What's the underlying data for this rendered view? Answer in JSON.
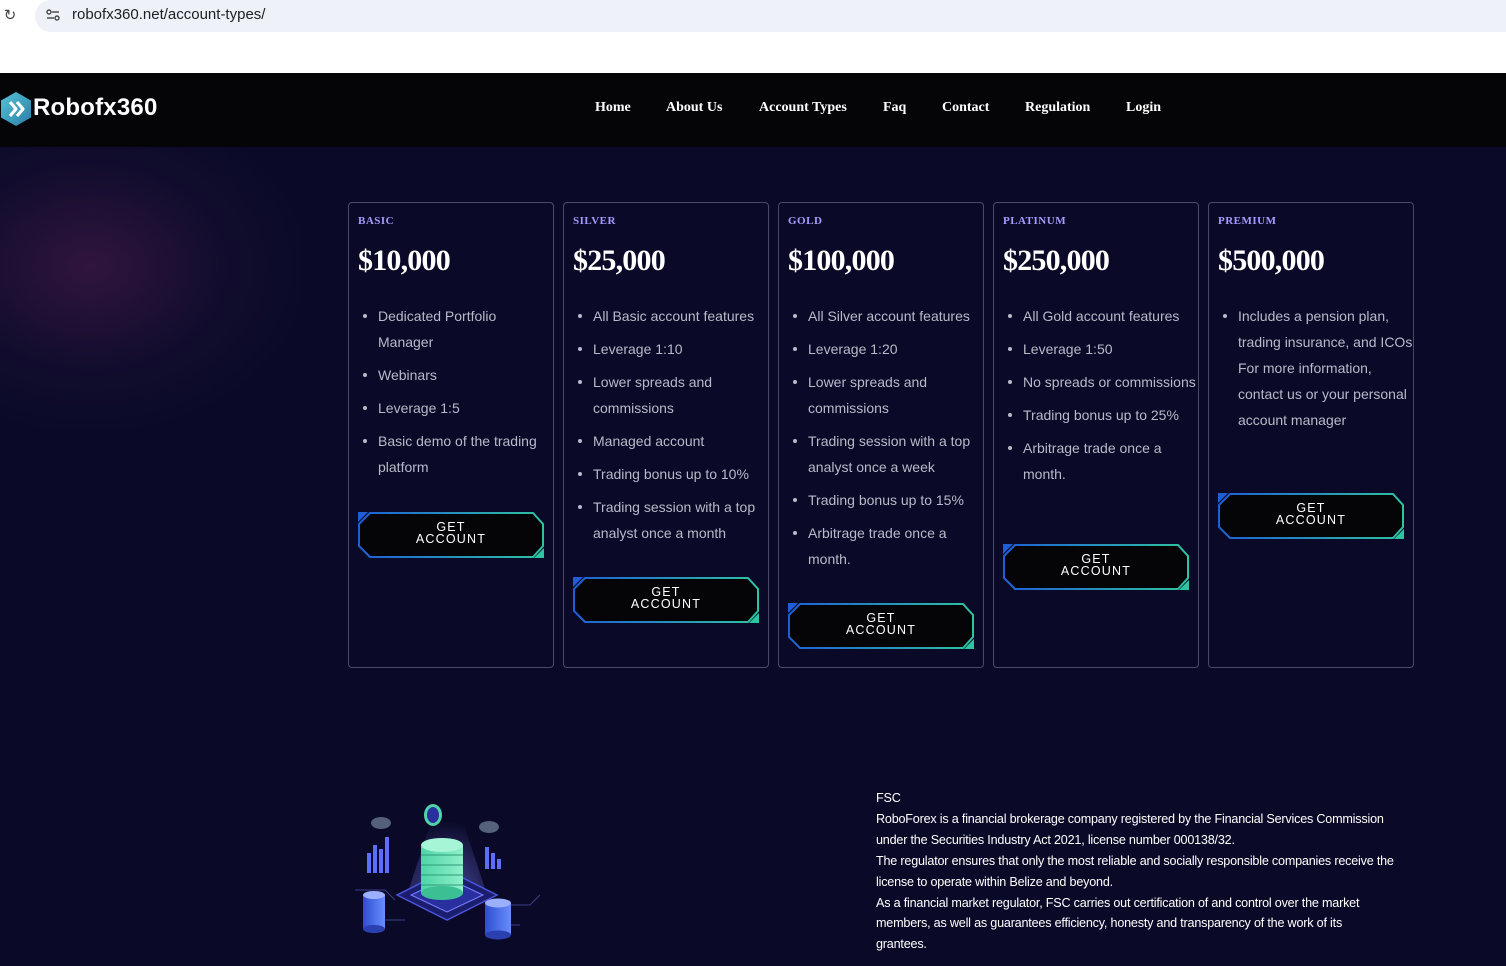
{
  "browser": {
    "url": "robofx360.net/account-types/"
  },
  "brand": {
    "name": "Robofx360"
  },
  "nav": {
    "items": [
      "Home",
      "About Us",
      "Account Types",
      "Faq",
      "Contact",
      "Regulation",
      "Login"
    ]
  },
  "plans": [
    {
      "tier": "BASIC",
      "price": "$10,000",
      "features": [
        "Dedicated Portfolio Manager",
        "Webinars",
        "Leverage 1:5",
        "Basic demo of the trading platform"
      ],
      "button": "GET ACCOUNT"
    },
    {
      "tier": "SILVER",
      "price": "$25,000",
      "features": [
        "All Basic account features",
        "Leverage 1:10",
        "Lower spreads and commissions",
        "Managed account",
        "Trading bonus up to 10%",
        "Trading session with a top analyst once a month"
      ],
      "button": "GET ACCOUNT"
    },
    {
      "tier": "GOLD",
      "price": "$100,000",
      "features": [
        "All Silver account features",
        "Leverage 1:20",
        "Lower spreads and commissions",
        "Trading session with a top analyst once a week",
        "Trading bonus up to 15%",
        "Arbitrage trade once a month."
      ],
      "button": "GET ACCOUNT"
    },
    {
      "tier": "PLATINUM",
      "price": "$250,000",
      "features": [
        "All Gold account features",
        "Leverage 1:50",
        "No spreads or commissions",
        "Trading bonus up to 25%",
        "Arbitrage trade once a month."
      ],
      "button": "GET ACCOUNT"
    },
    {
      "tier": "PREMIUM",
      "price": "$500,000",
      "features": [
        "Includes a pension plan, trading insurance, and ICOs For more information, contact us or your personal account manager"
      ],
      "button": "GET ACCOUNT"
    }
  ],
  "regulation": {
    "heading": "FSC",
    "paragraph1": "RoboForex is a financial brokerage company registered by the Financial Services Commission under the Securities Industry Act 2021, license number 000138/32.",
    "paragraph2": "The regulator ensures that only the most reliable and socially responsible companies receive the license to operate within Belize and beyond.",
    "paragraph3": "As a financial market regulator, FSC carries out certification of and control over the market members, as well as guarantees efficiency, honesty and transparency of the work of its grantees."
  },
  "colors": {
    "background": "#0a0a28",
    "navbar": "#050507",
    "tier_label": "#a89aff",
    "button_gradient_start": "#1e5fd8",
    "button_gradient_end": "#2ec4a0"
  }
}
